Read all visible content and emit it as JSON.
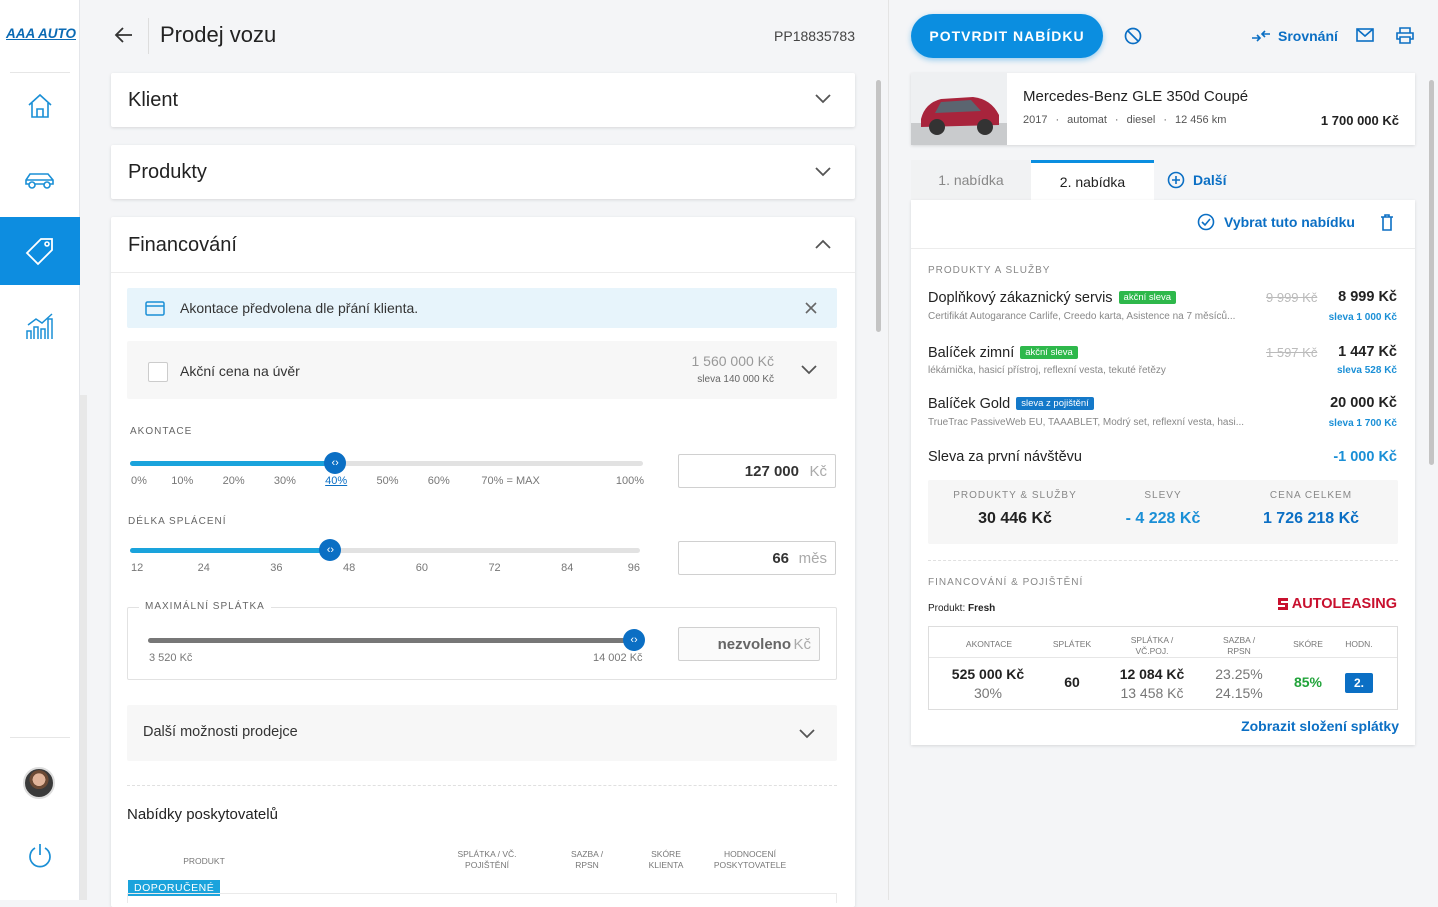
{
  "brand": {
    "logo": "AAA AUTO"
  },
  "header": {
    "title": "Prodej vozu",
    "id": "PP18835783"
  },
  "sections": {
    "client": "Klient",
    "products": "Produkty",
    "financing": "Financování"
  },
  "alert": {
    "text": "Akontace předvolena dle přání klienta."
  },
  "action_price": {
    "label": "Akční cena na úvěr",
    "price": "1 560 000 Kč",
    "discount": "sleva 140 000 Kč"
  },
  "akontace": {
    "label": "AKONTACE",
    "value": "127 000",
    "unit": "Kč",
    "fraction": 0.4,
    "ticks": [
      "0%",
      "10%",
      "20%",
      "30%",
      "40%",
      "50%",
      "60%",
      "70% = MAX",
      "100%"
    ]
  },
  "term": {
    "label": "DÉLKA SPLÁCENÍ",
    "value": "66",
    "unit": "měs",
    "fraction": 0.393,
    "ticks": [
      "12",
      "24",
      "36",
      "48",
      "60",
      "72",
      "84",
      "96"
    ]
  },
  "max_installment": {
    "label": "MAXIMÁLNÍ SPLÁTKA",
    "min": "3 520 Kč",
    "max": "14 002 Kč",
    "value": "nezvoleno",
    "unit": "Kč",
    "fraction": 1.0
  },
  "more_options": "Další možnosti prodejce",
  "providers": {
    "title": "Nabídky poskytovatelů",
    "col_product": "PRODUKT",
    "col_installment": "SPLÁTKA / VČ. POJIŠTĚNÍ",
    "col_rate": "SAZBA / RPSN",
    "col_score": "SKÓRE KLIENTA",
    "col_rating": "HODNOCENÍ POSKYTOVATELE",
    "recommended": "DOPORUČENÉ"
  },
  "right": {
    "confirm": "POTVRDIT NABÍDKU",
    "compare": "Srovnání",
    "car": {
      "name": "Mercedes-Benz GLE 350d Coupé",
      "year": "2017",
      "transmission": "automat",
      "fuel": "diesel",
      "km": "12 456 km",
      "price": "1 700 000 Kč"
    },
    "tabs": [
      "1. nabídka",
      "2. nabídka",
      "Další"
    ],
    "select_offer": "Vybrat tuto nabídku",
    "products_label": "PRODUKTY A SLUŽBY",
    "products": [
      {
        "name": "Doplňkový zákaznický servis",
        "badge": "akční sleva",
        "badge_color": "#2eb84b",
        "desc": "Certifikát Autogarance Carlife, Creedo karta, Asistence na 7 měsíců...",
        "old": "9 999 Kč",
        "price": "8 999 Kč",
        "disc": "sleva 1 000 Kč"
      },
      {
        "name": "Balíček zimní",
        "badge": "akční sleva",
        "badge_color": "#2eb84b",
        "desc": "lékárnička, hasicí přístroj, reflexní vesta, tekuté řetězy",
        "old": "1 597 Kč",
        "price": "1 447 Kč",
        "disc": "sleva 528 Kč"
      },
      {
        "name": "Balíček Gold",
        "badge": "sleva z pojištění",
        "badge_color": "#1479c9",
        "desc": "TrueTrac PassiveWeb EU, TAAABLET, Modrý set, reflexní vesta, hasi...",
        "old": "",
        "price": "20 000 Kč",
        "disc": "sleva 1 700 Kč"
      }
    ],
    "first_visit": {
      "label": "Sleva za první návštěvu",
      "value": "-1 000 Kč"
    },
    "summary": {
      "h1": "PRODUKTY & SLUŽBY",
      "v1": "30 446 Kč",
      "h2": "SLEVY",
      "v2": "- 4 228 Kč",
      "h3": "CENA CELKEM",
      "v3": "1 726 218 Kč"
    },
    "fin_label": "FINANCOVÁNÍ & POJIŠTĚNÍ",
    "fin_product_label": "Produkt:",
    "fin_product": "Fresh",
    "provider": "AUTOLEASING",
    "fin_headers": [
      "AKONTACE",
      "SPLÁTEK",
      "SPLÁTKA / VČ.POJ.",
      "SAZBA / RPSN",
      "SKÓRE",
      "HODN."
    ],
    "fin_values": {
      "down": "525 000 Kč",
      "down_pct": "30%",
      "count": "60",
      "inst": "12 084 Kč",
      "inst_ins": "13 458 Kč",
      "rate": "23.25%",
      "rpsn": "24.15%",
      "score": "85%",
      "rating": "2."
    },
    "show_breakdown": "Zobrazit složení splátky"
  }
}
